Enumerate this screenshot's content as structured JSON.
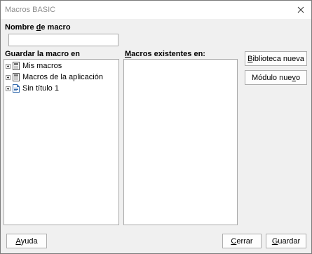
{
  "window": {
    "title": "Macros BASIC"
  },
  "macro_name": {
    "label": "Nombre de macro",
    "value": ""
  },
  "save_in": {
    "label": "Guardar la macro en",
    "items": [
      {
        "label": "Mis macros",
        "icon": "macro-library-icon"
      },
      {
        "label": "Macros de la aplicación",
        "icon": "macro-library-icon"
      },
      {
        "label": "Sin título 1",
        "icon": "document-icon"
      }
    ]
  },
  "existing": {
    "label": "Macros existentes en:"
  },
  "buttons": {
    "new_library": "Biblioteca nueva",
    "new_module": "Módulo nuevo",
    "help": "Ayuda",
    "close": "Cerrar",
    "save": "Guardar"
  }
}
